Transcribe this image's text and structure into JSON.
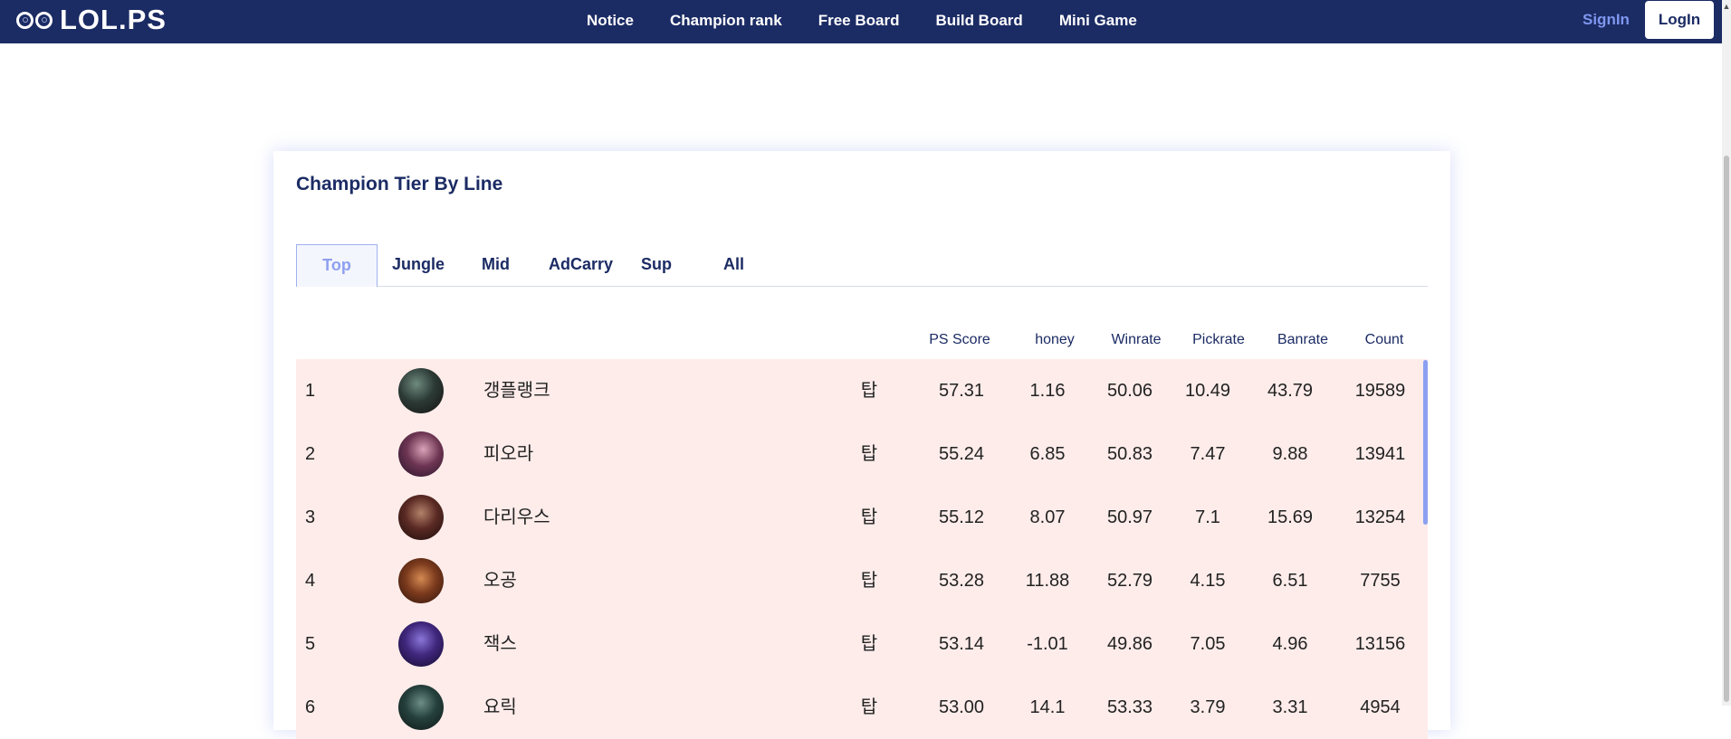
{
  "header": {
    "logo_text": "LOL.PS",
    "nav": [
      "Notice",
      "Champion rank",
      "Free Board",
      "Build Board",
      "Mini Game"
    ],
    "signin_label": "SignIn",
    "login_label": "LogIn"
  },
  "card": {
    "title": "Champion Tier By Line",
    "tabs": [
      "Top",
      "Jungle",
      "Mid",
      "AdCarry",
      "Sup",
      "All"
    ],
    "active_tab": "Top"
  },
  "table": {
    "columns": [
      "PS Score",
      "honey",
      "Winrate",
      "Pickrate",
      "Banrate",
      "Count"
    ],
    "rows": [
      {
        "rank": "1",
        "name": "갱플랭크",
        "line": "탑",
        "ps_score": "57.31",
        "honey": "1.16",
        "winrate": "50.06",
        "pickrate": "10.49",
        "banrate": "43.79",
        "count": "19589"
      },
      {
        "rank": "2",
        "name": "피오라",
        "line": "탑",
        "ps_score": "55.24",
        "honey": "6.85",
        "winrate": "50.83",
        "pickrate": "7.47",
        "banrate": "9.88",
        "count": "13941"
      },
      {
        "rank": "3",
        "name": "다리우스",
        "line": "탑",
        "ps_score": "55.12",
        "honey": "8.07",
        "winrate": "50.97",
        "pickrate": "7.1",
        "banrate": "15.69",
        "count": "13254"
      },
      {
        "rank": "4",
        "name": "오공",
        "line": "탑",
        "ps_score": "53.28",
        "honey": "11.88",
        "winrate": "52.79",
        "pickrate": "4.15",
        "banrate": "6.51",
        "count": "7755"
      },
      {
        "rank": "5",
        "name": "잭스",
        "line": "탑",
        "ps_score": "53.14",
        "honey": "-1.01",
        "winrate": "49.86",
        "pickrate": "7.05",
        "banrate": "4.96",
        "count": "13156"
      },
      {
        "rank": "6",
        "name": "요릭",
        "line": "탑",
        "ps_score": "53.00",
        "honey": "14.1",
        "winrate": "53.33",
        "pickrate": "3.79",
        "banrate": "3.31",
        "count": "4954"
      }
    ]
  },
  "colors": {
    "header_bg": "#1b2b64",
    "accent": "#8ea0f0",
    "row_bg": "#fdecea"
  }
}
